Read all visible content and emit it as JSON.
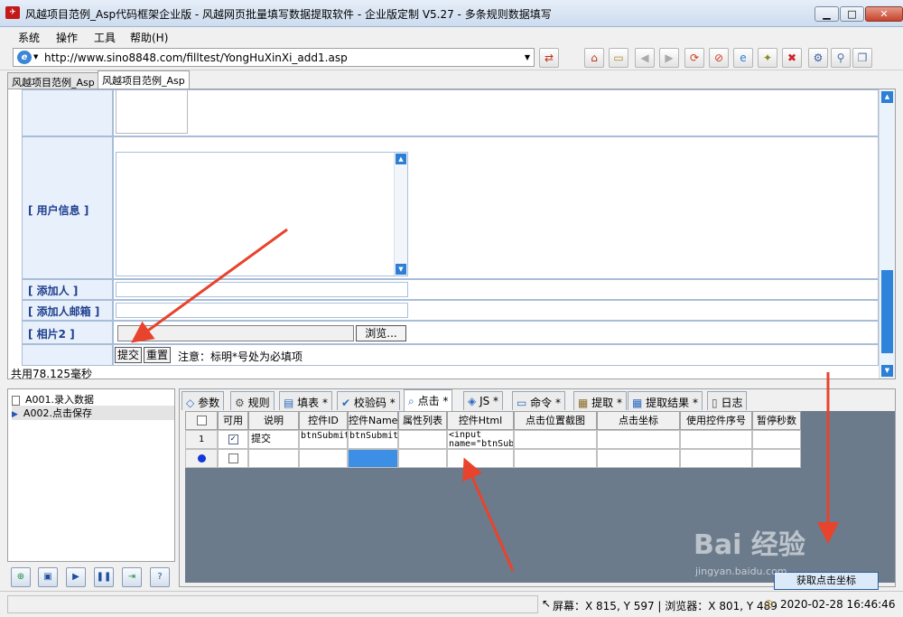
{
  "window": {
    "title": "风越项目范例_Asp代码框架企业版 - 风越网页批量填写数据提取软件 - 企业版定制 V5.27 - 多条规则数据填写"
  },
  "menu": [
    "系统",
    "操作",
    "工具",
    "帮助(H)"
  ],
  "address": {
    "url": "http://www.sino8848.com/filltest/YongHuXinXi_add1.asp"
  },
  "doc_tabs": [
    "风越项目范例_Asp",
    "风越项目范例_Asp"
  ],
  "form": {
    "user_info_label": "[ 用户信息 ]",
    "adder_label": "[ 添加人 ]",
    "adder_email_label": "[ 添加人邮箱 ]",
    "photo2_label": "[ 相片2 ]",
    "browse_label": "浏览...",
    "submit_label": "提交",
    "reset_label": "重置",
    "note": "注意：标明*号处为必填项"
  },
  "timing": "共用78.125毫秒",
  "steps": [
    "A001.录入数据",
    "A002.点击保存"
  ],
  "panel_tabs": [
    "参数",
    "规则",
    "填表 *",
    "校验码 *",
    "点击 *",
    "JS *",
    "命令 *",
    "提取 *",
    "提取结果 *",
    "日志"
  ],
  "grid": {
    "headers": [
      "可用",
      "说明",
      "控件ID",
      "控件Name",
      "属性列表",
      "控件Html",
      "点击位置截图",
      "点击坐标",
      "使用控件序号",
      "暂停秒数"
    ],
    "rows": [
      {
        "no": "1",
        "desc": "提交",
        "ctrl_id": "btnSubmit",
        "ctrl_name": "btnSubmit",
        "html": "<input name=\"btnSubm"
      }
    ]
  },
  "grab_button": "获取点击坐标",
  "status": {
    "coords": "屏幕：X 815, Y 597 | 浏览器：X 801, Y 489",
    "datetime": "2020-02-28 16:46:46"
  },
  "watermark": "Bai 经验",
  "watermark_sub": "jingyan.baidu.com",
  "colors": {
    "accent": "#2e83da",
    "arrow": "#e8432c",
    "label_blue": "#1f3f8f"
  }
}
